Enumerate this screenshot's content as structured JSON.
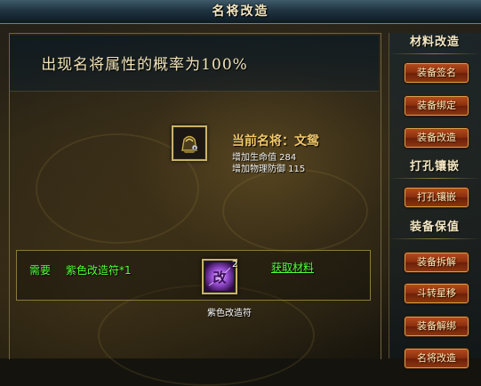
{
  "window": {
    "title": "名将改造"
  },
  "probability": {
    "text": "出现名将属性的概率为100%"
  },
  "current": {
    "name": "当前名将：文鸳",
    "stats": [
      "增加生命值 284",
      "增加物理防御 115"
    ],
    "icon": "helmet-equipment-icon"
  },
  "requirement": {
    "label": "需要",
    "item": "紫色改造符*1",
    "count": "2",
    "caption": "紫色改造符",
    "get_link": "获取材料",
    "icon": "purple-transform-rune-icon",
    "icon_glyph": "改"
  },
  "sidebar": {
    "sections": [
      {
        "title": "材料改造",
        "buttons": [
          "装备签名",
          "装备绑定",
          "装备改造"
        ]
      },
      {
        "title": "打孔镶嵌",
        "buttons": [
          "打孔镶嵌"
        ]
      },
      {
        "title": "装备保值",
        "buttons": [
          "装备拆解",
          "斗转星移",
          "装备解绑",
          "名将改造"
        ]
      }
    ]
  },
  "colors": {
    "accent_gold": "#f1c86b",
    "green_text": "#52ff3a",
    "button_red": "#8a2f0e",
    "button_border": "#d8a04b"
  }
}
